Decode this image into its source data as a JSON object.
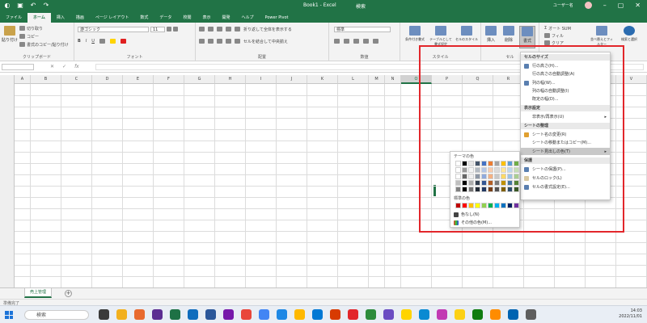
{
  "titlebar": {
    "title": "Book1 - Excel",
    "search_placeholder": "検索",
    "account": "ユーザー名"
  },
  "menubar": {
    "tabs": [
      "ファイル",
      "ホーム",
      "挿入",
      "描画",
      "ページ レイアウト",
      "数式",
      "データ",
      "校閲",
      "表示",
      "開発",
      "ヘルプ",
      "Power Pivot"
    ],
    "active_index": 1
  },
  "ribbon": {
    "groups": [
      {
        "label": "クリップボード"
      },
      {
        "label": "フォント"
      },
      {
        "label": "配置"
      },
      {
        "label": "数値"
      },
      {
        "label": "スタイル"
      },
      {
        "label": "セル"
      },
      {
        "label": "編集"
      }
    ],
    "clipboard": {
      "cut": "切り取り",
      "copy": "コピー",
      "format_painter": "書式のコピー/貼り付け",
      "paste": "貼り付け"
    },
    "font": {
      "name": "游ゴシック",
      "size": "11"
    },
    "alignment": {
      "wrap": "折り返して全体を表示する",
      "merge": "セルを結合して中央揃え"
    },
    "number": {
      "format": "標準"
    },
    "styles": {
      "conditional": "条件付き書式",
      "table": "テーブルとして書式設定",
      "cell_styles": "セルのスタイル"
    },
    "cells": {
      "insert": "挿入",
      "delete": "削除",
      "format": "書式"
    },
    "editing": {
      "autosum": "オート SUM",
      "fill": "フィル",
      "clear": "クリア",
      "sort": "並べ替えとフィルター",
      "find": "検索と選択"
    }
  },
  "formulabar": {
    "fx": "fx"
  },
  "grid": {
    "columns": [
      "A",
      "B",
      "C",
      "D",
      "E",
      "F",
      "G",
      "H",
      "I",
      "J",
      "K",
      "L",
      "M",
      "N",
      "O",
      "P",
      "Q",
      "R",
      "S",
      "T",
      "U",
      "V"
    ],
    "selected_column": "O"
  },
  "sheets": {
    "tabs": [
      "売上管理"
    ]
  },
  "status": {
    "text": "準備完了"
  },
  "taskbar": {
    "search": "検索",
    "time": "14:03",
    "date": "2022/11/01"
  },
  "format_menu": {
    "sections": {
      "cell_size": "セルのサイズ",
      "visibility": "表示設定",
      "organize": "シートの整理",
      "protection": "保護"
    },
    "items": {
      "row_height": "行の高さ(H)...",
      "autofit_row": "行の高さの自動調整(A)",
      "column_width": "列の幅(W)...",
      "autofit_column": "列の幅の自動調整(I)",
      "default_width": "既定の幅(D)...",
      "hide_unhide": "非表示/再表示(U)",
      "rename": "シート名の変更(R)",
      "move_copy": "シートの移動またはコピー(M)...",
      "tab_color": "シート見出しの色(T)",
      "protect_sheet": "シートの保護(P)...",
      "lock_cell": "セルのロック(L)",
      "format_cells": "セルの書式設定(E)..."
    }
  },
  "tab_color_palette": {
    "theme_label": "テーマの色",
    "standard_label": "標準の色",
    "no_color": "色なし(N)",
    "more_colors": "その他の色(M)...",
    "theme_colors": [
      "#ffffff",
      "#000000",
      "#e7e6e6",
      "#44546a",
      "#4472c4",
      "#ed7d31",
      "#a5a5a5",
      "#ffc000",
      "#5b9bd5",
      "#70ad47"
    ],
    "standard_colors": [
      "#c00000",
      "#ff0000",
      "#ffc000",
      "#ffff00",
      "#92d050",
      "#00b050",
      "#00b0f0",
      "#0070c0",
      "#002060",
      "#7030a0"
    ]
  }
}
